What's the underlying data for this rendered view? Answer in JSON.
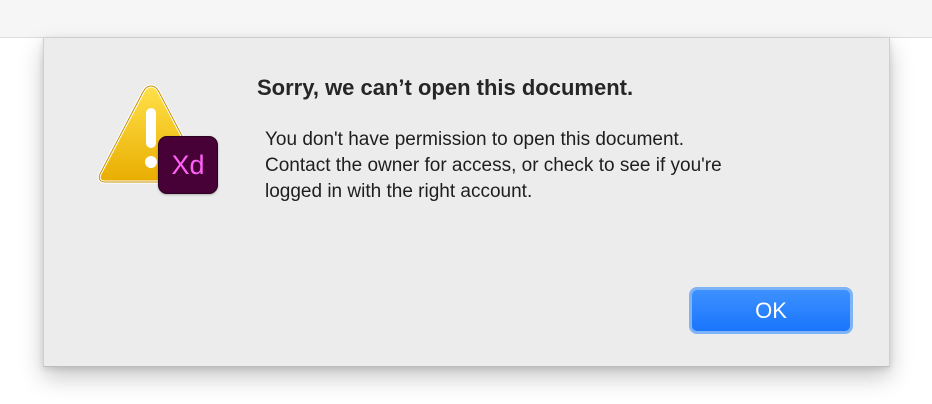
{
  "dialog": {
    "title": "Sorry, we can’t open this document.",
    "message_lines": [
      "You don't have permission to open this document.",
      "Contact the owner for access, or check to see if you're",
      "logged in with the right account."
    ],
    "ok_label": "OK",
    "app_badge": "Xd",
    "icons": {
      "warning": "warning-icon",
      "app": "adobe-xd-icon"
    },
    "colors": {
      "button": "#1a75fc",
      "button_focus_ring": "#7eb3f8",
      "badge_bg": "#470137",
      "badge_text": "#ff61f6",
      "warning": "#f2c200"
    }
  }
}
